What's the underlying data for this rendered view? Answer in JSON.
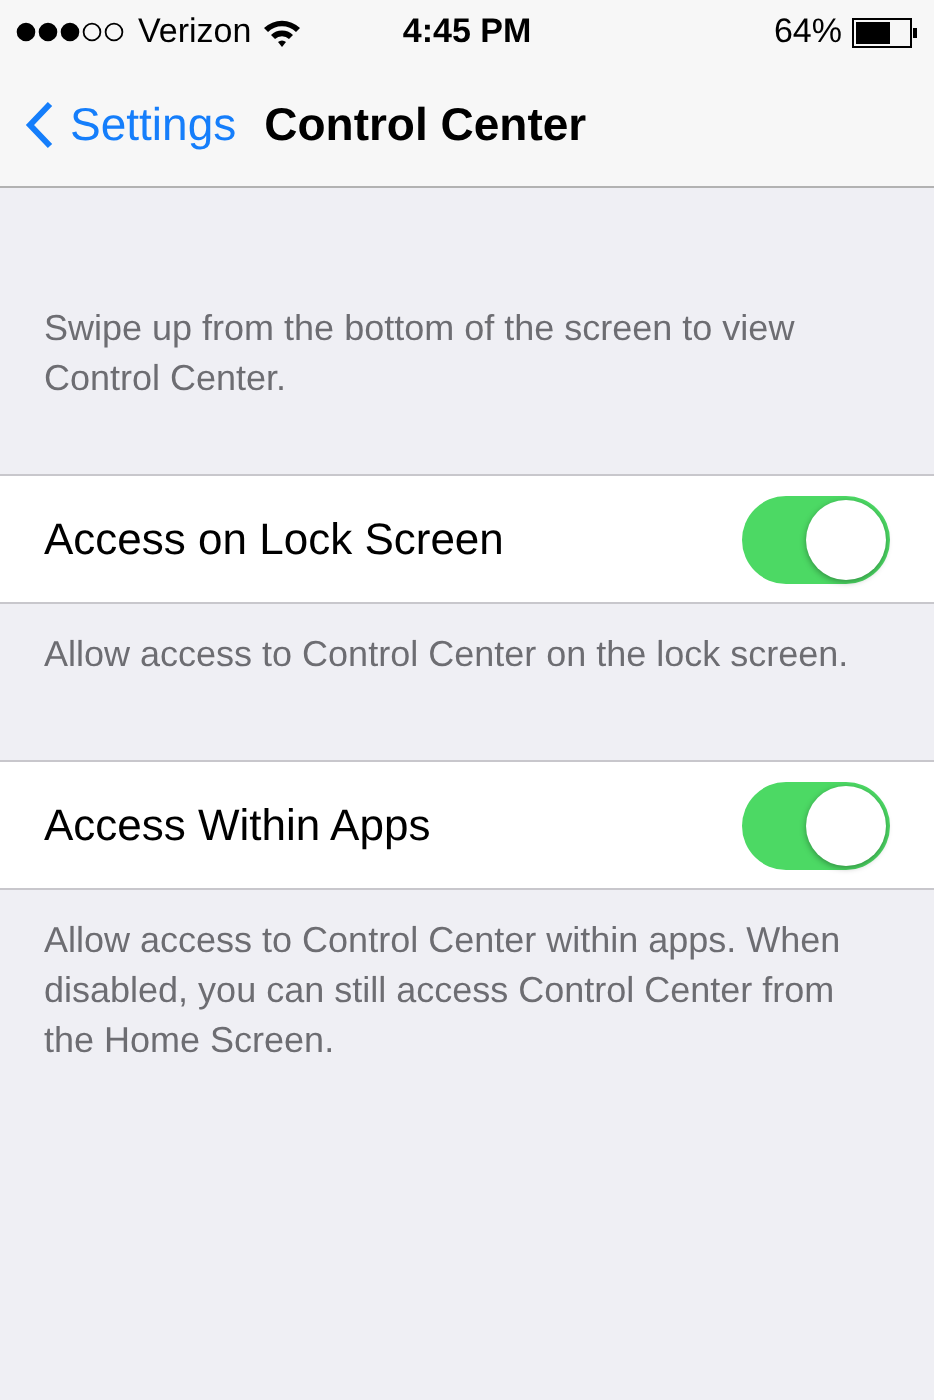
{
  "status_bar": {
    "carrier": "Verizon",
    "time": "4:45 PM",
    "battery": "64%"
  },
  "nav": {
    "back": "Settings",
    "title": "Control Center"
  },
  "intro": "Swipe up from the bottom of the screen to view Control Center.",
  "sections": [
    {
      "label": "Access on Lock Screen",
      "on": true,
      "footer": "Allow access to Control Center on the lock screen."
    },
    {
      "label": "Access Within Apps",
      "on": true,
      "footer": "Allow access to Control Center within apps. When disabled, you can still access Control Center from the Home Screen."
    }
  ]
}
